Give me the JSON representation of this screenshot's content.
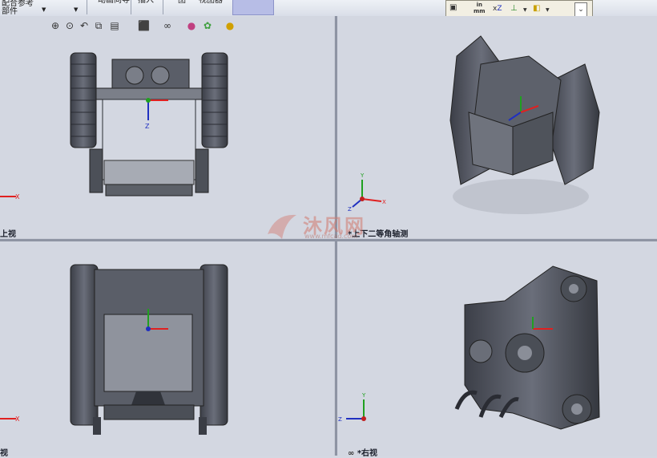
{
  "toolbar": {
    "item1_line1": "配合参考",
    "item1_line2": "部件",
    "item2": "动画向导",
    "item3": "插入",
    "item4": "图",
    "item5": "视图器"
  },
  "float_toolbar": {
    "units_top": "in",
    "units_bottom": "mm",
    "axis_label": "Z"
  },
  "sidebar_tab": "品",
  "viewports": {
    "top_left": {
      "label": "上视"
    },
    "top_right": {
      "label": "*上下二等角轴测"
    },
    "bottom_left": {
      "label": "视"
    },
    "bottom_right": {
      "label": "*右视"
    }
  },
  "triad_labels": {
    "x": "X",
    "y": "Y",
    "z": "Z"
  },
  "watermark": {
    "text": "沐风网",
    "url": "www.mfcad.com"
  },
  "colors": {
    "viewport_bg": "#d3d7e1",
    "x_axis": "#e02020",
    "y_axis": "#20a020",
    "z_axis": "#2030c0"
  }
}
